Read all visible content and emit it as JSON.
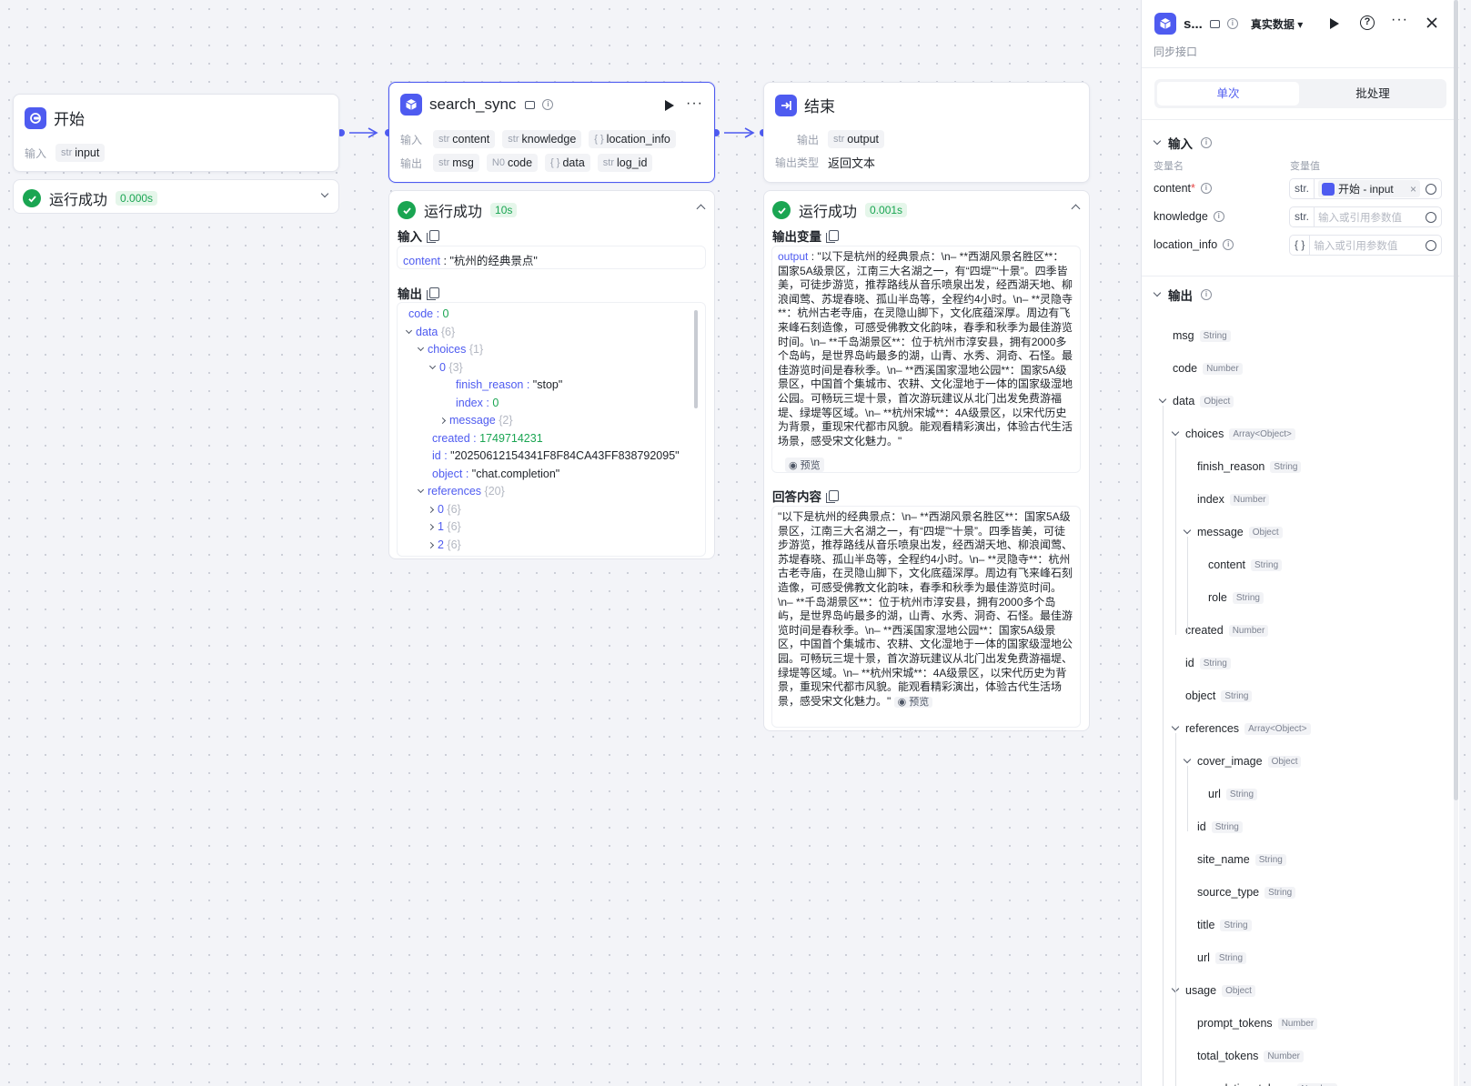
{
  "start_node": {
    "title": "开始",
    "io_label": "输入",
    "inputs": [
      {
        "type": "str",
        "name": "input"
      }
    ]
  },
  "start_run": {
    "status": "运行成功",
    "time": "0.000s"
  },
  "search_node": {
    "title": "search_sync",
    "in_label": "输入",
    "out_label": "输出",
    "inputs": [
      {
        "type": "str",
        "name": "content"
      },
      {
        "type": "str",
        "name": "knowledge"
      },
      {
        "type": "{ }",
        "name": "location_info"
      }
    ],
    "outputs": [
      {
        "type": "str",
        "name": "msg"
      },
      {
        "type": "N0",
        "name": "code"
      },
      {
        "type": "{ }",
        "name": "data"
      },
      {
        "type": "str",
        "name": "log_id"
      }
    ]
  },
  "search_run": {
    "status": "运行成功",
    "time": "10s",
    "input_label": "输入",
    "input_key": "content",
    "input_value": "\"杭州的经典景点\"",
    "output_label": "输出",
    "tree": [
      {
        "indent": 0,
        "arrow": "",
        "key": "code",
        "sep": " : ",
        "val": "0",
        "vclass": "num"
      },
      {
        "indent": 0,
        "arrow": "down",
        "key": "data",
        "sep": "",
        "val": " {6}",
        "vclass": "cnt"
      },
      {
        "indent": 1,
        "arrow": "down",
        "key": "choices",
        "sep": "",
        "val": " {1}",
        "vclass": "cnt"
      },
      {
        "indent": 2,
        "arrow": "down",
        "key": "0",
        "sep": "",
        "val": " {3}",
        "vclass": "cnt"
      },
      {
        "indent": 4,
        "arrow": "",
        "key": "finish_reason",
        "sep": " : ",
        "val": "\"stop\"",
        "vclass": "str"
      },
      {
        "indent": 4,
        "arrow": "",
        "key": "index",
        "sep": " : ",
        "val": "0",
        "vclass": "num"
      },
      {
        "indent": 3,
        "arrow": "right",
        "key": "message",
        "sep": "",
        "val": " {2}",
        "vclass": "cnt"
      },
      {
        "indent": 2,
        "arrow": "",
        "key": "created",
        "sep": " : ",
        "val": "1749714231",
        "vclass": "num"
      },
      {
        "indent": 2,
        "arrow": "",
        "key": "id",
        "sep": " : ",
        "val": "\"20250612154341F8F84CA43FF838792095\"",
        "vclass": "str"
      },
      {
        "indent": 2,
        "arrow": "",
        "key": "object",
        "sep": " : ",
        "val": "\"chat.completion\"",
        "vclass": "str"
      },
      {
        "indent": 1,
        "arrow": "down",
        "key": "references",
        "sep": "",
        "val": " {20}",
        "vclass": "cnt"
      },
      {
        "indent": 2,
        "arrow": "right",
        "key": "0",
        "sep": "",
        "val": " {6}",
        "vclass": "cnt"
      },
      {
        "indent": 2,
        "arrow": "right",
        "key": "1",
        "sep": "",
        "val": " {6}",
        "vclass": "cnt"
      },
      {
        "indent": 2,
        "arrow": "right",
        "key": "2",
        "sep": "",
        "val": " {6}",
        "vclass": "cnt"
      }
    ]
  },
  "end_node": {
    "title": "结束",
    "out_label": "输出",
    "out_type": "str",
    "out_name": "output",
    "mode_label": "输出类型",
    "mode_value": "返回文本"
  },
  "end_run": {
    "status": "运行成功",
    "time": "0.001s",
    "var_label": "输出变量",
    "var_key": "output",
    "preview": "预览",
    "var_text": "\"以下是杭州的经典景点：\\n– **西湖风景名胜区**：国家5A级景区，江南三大名湖之一，有“四堤”“十景”。四季皆美，可徒步游览，推荐路线从音乐喷泉出发，经西湖天地、柳浪闻莺、苏堤春晓、孤山半岛等，全程约4小时。\\n– **灵隐寺**：杭州古老寺庙，在灵隐山脚下，文化底蕴深厚。周边有飞来峰石刻造像，可感受佛教文化韵味，春季和秋季为最佳游览时间。\\n– **千岛湖景区**：位于杭州市淳安县，拥有2000多个岛屿，是世界岛屿最多的湖，山青、水秀、洞奇、石怪。最佳游览时间是春秋季。\\n– **西溪国家湿地公园**：国家5A级景区，中国首个集城市、农耕、文化湿地于一体的国家级湿地公园。可畅玩三堤十景，首次游玩建议从北门出发免费游福堤、绿堤等区域。\\n– **杭州宋城**：4A级景区，以宋代历史为背景，重现宋代都市风貌。能观看精彩演出，体验古代生活场景，感受宋文化魅力。\"",
    "answer_label": "回答内容",
    "answer_text": "\"以下是杭州的经典景点：\\n– **西湖风景名胜区**：国家5A级景区，江南三大名湖之一，有“四堤”“十景”。四季皆美，可徒步游览，推荐路线从音乐喷泉出发，经西湖天地、柳浪闻莺、苏堤春晓、孤山半岛等，全程约4小时。\\n– **灵隐寺**：杭州古老寺庙，在灵隐山脚下，文化底蕴深厚。周边有飞来峰石刻造像，可感受佛教文化韵味，春季和秋季为最佳游览时间。\\n– **千岛湖景区**：位于杭州市淳安县，拥有2000多个岛屿，是世界岛屿最多的湖，山青、水秀、洞奇、石怪。最佳游览时间是春秋季。\\n– **西溪国家湿地公园**：国家5A级景区，中国首个集城市、农耕、文化湿地于一体的国家级湿地公园。可畅玩三堤十景，首次游玩建议从北门出发免费游福堤、绿堤等区域。\\n– **杭州宋城**：4A级景区，以宋代历史为背景，重现宋代都市风貌。能观看精彩演出，体验古代生活场景，感受宋文化魅力。\""
  },
  "panel": {
    "title": "s...",
    "data_mode": "真实数据",
    "subtitle": "同步接口",
    "tabs": [
      "单次",
      "批处理"
    ],
    "input_section": "输入",
    "col_name": "变量名",
    "col_value": "变量值",
    "params": [
      {
        "name": "content",
        "required": true,
        "type": "str.",
        "ref": "开始 - input",
        "placeholder": ""
      },
      {
        "name": "knowledge",
        "required": false,
        "type": "str.",
        "ref": "",
        "placeholder": "输入或引用参数值"
      },
      {
        "name": "location_info",
        "required": false,
        "type": "{ }",
        "ref": "",
        "placeholder": "输入或引用参数值"
      }
    ],
    "output_section": "输出",
    "outputs": [
      {
        "level": 0,
        "name": "msg",
        "type": "String",
        "arrow": false
      },
      {
        "level": 0,
        "name": "code",
        "type": "Number",
        "arrow": false
      },
      {
        "level": 0,
        "name": "data",
        "type": "Object",
        "arrow": true
      },
      {
        "level": 1,
        "name": "choices",
        "type": "Array<Object>",
        "arrow": true
      },
      {
        "level": 2,
        "name": "finish_reason",
        "type": "String",
        "arrow": false
      },
      {
        "level": 2,
        "name": "index",
        "type": "Number",
        "arrow": false
      },
      {
        "level": 2,
        "name": "message",
        "type": "Object",
        "arrow": true
      },
      {
        "level": 3,
        "name": "content",
        "type": "String",
        "arrow": false
      },
      {
        "level": 3,
        "name": "role",
        "type": "String",
        "arrow": false
      },
      {
        "level": 1,
        "name": "created",
        "type": "Number",
        "arrow": false
      },
      {
        "level": 1,
        "name": "id",
        "type": "String",
        "arrow": false
      },
      {
        "level": 1,
        "name": "object",
        "type": "String",
        "arrow": false
      },
      {
        "level": 1,
        "name": "references",
        "type": "Array<Object>",
        "arrow": true
      },
      {
        "level": 2,
        "name": "cover_image",
        "type": "Object",
        "arrow": true
      },
      {
        "level": 3,
        "name": "url",
        "type": "String",
        "arrow": false
      },
      {
        "level": 2,
        "name": "id",
        "type": "String",
        "arrow": false
      },
      {
        "level": 2,
        "name": "site_name",
        "type": "String",
        "arrow": false
      },
      {
        "level": 2,
        "name": "source_type",
        "type": "String",
        "arrow": false
      },
      {
        "level": 2,
        "name": "title",
        "type": "String",
        "arrow": false
      },
      {
        "level": 2,
        "name": "url",
        "type": "String",
        "arrow": false
      },
      {
        "level": 1,
        "name": "usage",
        "type": "Object",
        "arrow": true
      },
      {
        "level": 2,
        "name": "prompt_tokens",
        "type": "Number",
        "arrow": false
      },
      {
        "level": 2,
        "name": "total_tokens",
        "type": "Number",
        "arrow": false
      },
      {
        "level": 2,
        "name": "completion_tokens",
        "type": "Number",
        "arrow": false
      }
    ]
  },
  "colors": {
    "accent": "#4e5bf0",
    "success": "#1aa552"
  }
}
